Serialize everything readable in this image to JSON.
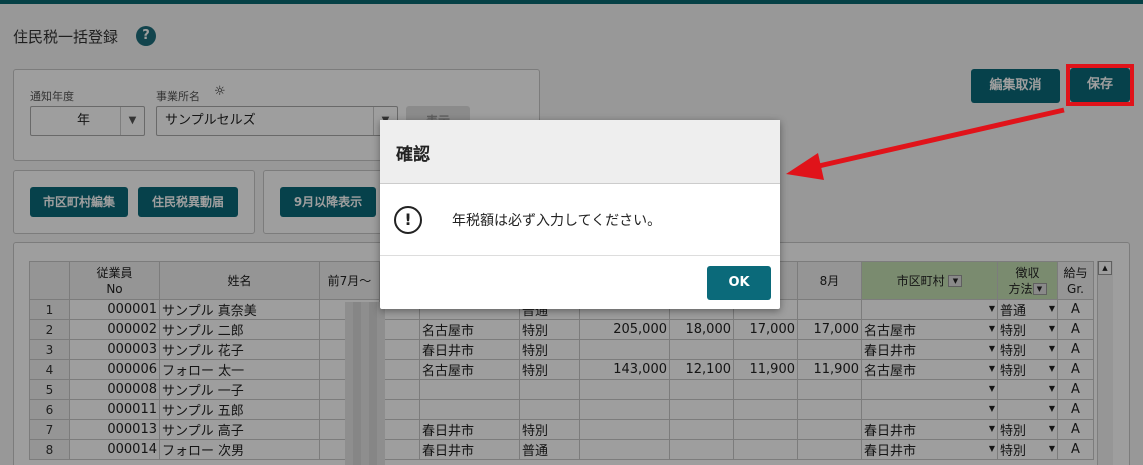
{
  "page": {
    "title": "住民税一括登録",
    "help_icon": "?"
  },
  "filter": {
    "year_label": "通知年度",
    "year_value": "年",
    "office_label": "事業所名",
    "office_value": "サンプルセルズ",
    "show_button": "表示"
  },
  "toolbar": {
    "city_edit": "市区町村編集",
    "tax_change": "住民税異動届",
    "after_sept": "9月以降表示",
    "cancel_edit": "編集取消",
    "save": "保存"
  },
  "grid": {
    "headers": {
      "employee_no": "従業員\nNo",
      "name": "姓名",
      "prev_july": "前7月～",
      "aug": "8月",
      "city": "市区町村",
      "collection": "徴収\n方法",
      "salary_gr": "給与\nGr."
    },
    "rows": [
      {
        "n": "1",
        "no": "000001",
        "name": "サンプル 真奈美",
        "city1": "",
        "type1": "普通",
        "v1": "",
        "v2": "",
        "v3": "",
        "v4": "",
        "city2": "",
        "method": "普通",
        "gr": "A"
      },
      {
        "n": "2",
        "no": "000002",
        "name": "サンプル 二郎",
        "city1": "名古屋市",
        "type1": "特別",
        "v1": "205,000",
        "v2": "18,000",
        "v3": "17,000",
        "v4": "17,000",
        "city2": "名古屋市",
        "method": "特別",
        "gr": "A"
      },
      {
        "n": "3",
        "no": "000003",
        "name": "サンプル 花子",
        "city1": "春日井市",
        "type1": "特別",
        "v1": "",
        "v2": "",
        "v3": "",
        "v4": "",
        "city2": "春日井市",
        "method": "特別",
        "gr": "A"
      },
      {
        "n": "4",
        "no": "000006",
        "name": "フォロー 太一",
        "city1": "名古屋市",
        "type1": "特別",
        "v1": "143,000",
        "v2": "12,100",
        "v3": "11,900",
        "v4": "11,900",
        "city2": "名古屋市",
        "method": "特別",
        "gr": "A"
      },
      {
        "n": "5",
        "no": "000008",
        "name": "サンプル 一子",
        "city1": "",
        "type1": "",
        "v1": "",
        "v2": "",
        "v3": "",
        "v4": "",
        "city2": "",
        "method": "",
        "gr": "A"
      },
      {
        "n": "6",
        "no": "000011",
        "name": "サンプル 五郎",
        "city1": "",
        "type1": "",
        "v1": "",
        "v2": "",
        "v3": "",
        "v4": "",
        "city2": "",
        "method": "",
        "gr": "A"
      },
      {
        "n": "7",
        "no": "000013",
        "name": "サンプル 高子",
        "city1": "春日井市",
        "type1": "特別",
        "v1": "",
        "v2": "",
        "v3": "",
        "v4": "",
        "city2": "春日井市",
        "method": "特別",
        "gr": "A"
      },
      {
        "n": "8",
        "no": "000014",
        "name": "フォロー 次男",
        "city1": "春日井市",
        "type1": "普通",
        "v1": "",
        "v2": "",
        "v3": "",
        "v4": "",
        "city2": "春日井市",
        "method": "特別",
        "gr": "A"
      }
    ]
  },
  "dialog": {
    "title": "確認",
    "message": "年税額は必ず入力してください。",
    "ok": "OK"
  },
  "colors": {
    "accent": "#0b6a7a",
    "highlight": "#e0131a"
  }
}
